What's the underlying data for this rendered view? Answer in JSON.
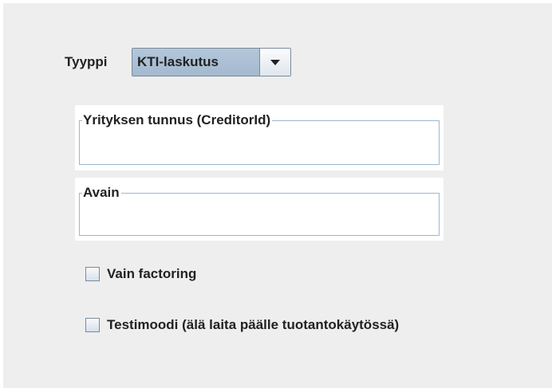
{
  "type_selector": {
    "label": "Tyyppi",
    "selected_value": "KTI-laskutus"
  },
  "creditor_field": {
    "title": "Yrityksen tunnus (CreditorId)",
    "value": ""
  },
  "key_field": {
    "title": "Avain",
    "value": ""
  },
  "checkboxes": [
    {
      "label": "Vain factoring",
      "checked": false
    },
    {
      "label": "Testimoodi (älä laita päälle tuotantokäytössä)",
      "checked": false
    }
  ],
  "colors": {
    "panel_background": "#eeeeee",
    "combo_selected_background": "#a4b9cf",
    "titled_border": "#9db7d1"
  },
  "icons": {
    "combo_arrow": "triangle-down-icon"
  }
}
